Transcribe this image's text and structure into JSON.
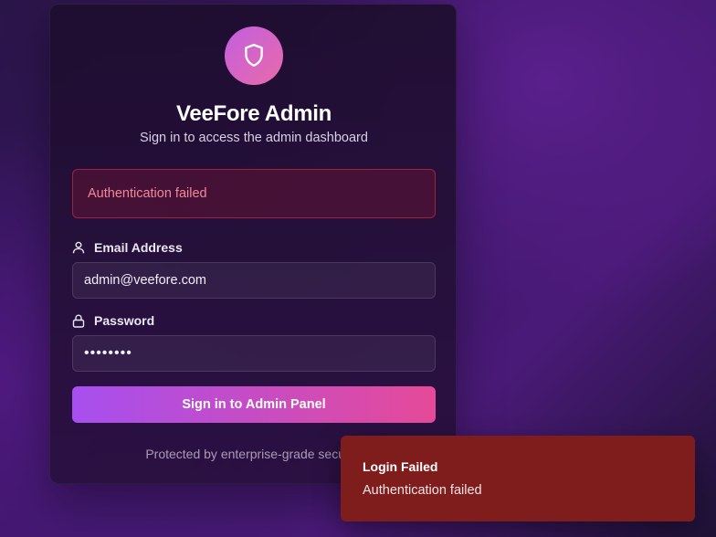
{
  "brand": {
    "title": "VeeFore Admin",
    "subtitle": "Sign in to access the admin dashboard",
    "logo_icon": "shield-icon",
    "accent_gradient": [
      "#a64ff0",
      "#e64a98"
    ]
  },
  "error": {
    "message": "Authentication failed",
    "color": "#f0899a"
  },
  "form": {
    "email": {
      "label": "Email Address",
      "icon": "user-icon",
      "value": "admin@veefore.com"
    },
    "password": {
      "label": "Password",
      "icon": "lock-icon",
      "value": "••••••••"
    },
    "submit_label": "Sign in to Admin Panel"
  },
  "footer": {
    "note": "Protected by enterprise-grade security"
  },
  "toast": {
    "title": "Login Failed",
    "message": "Authentication failed",
    "background": "#7f1d1d"
  }
}
